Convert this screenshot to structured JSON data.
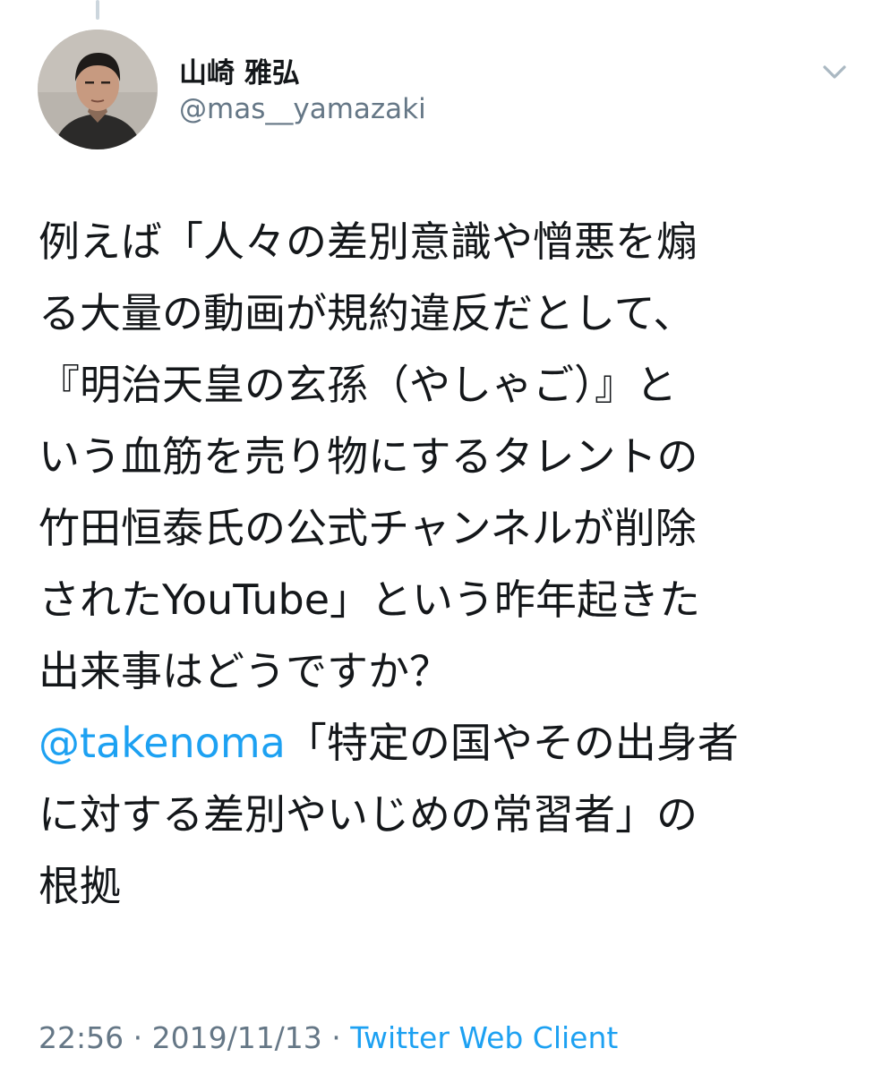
{
  "author": {
    "display_name": "山崎 雅弘",
    "handle": "@mas__yamazaki"
  },
  "icons": {
    "avatar": "profile-photo",
    "menu": "chevron-down-icon"
  },
  "tweet": {
    "lines": [
      {
        "text": "例えば「人々の差別意識や憎悪を煽"
      },
      {
        "text": "る大量の動画が規約違反だとして、"
      },
      {
        "text": "『明治天皇の玄孫（やしゃご）』と"
      },
      {
        "text": "いう血筋を売り物にするタレントの"
      },
      {
        "text": "竹田恒泰氏の公式チャンネルが削除"
      },
      {
        "text": "されたYouTube」という昨年起きた"
      },
      {
        "text": "出来事はどうですか？"
      },
      {
        "mention": "@takenoma",
        "text": "「特定の国やその出身者"
      },
      {
        "text": "に対する差別やいじめの常習者」の"
      },
      {
        "text": "根拠"
      }
    ]
  },
  "meta": {
    "time": "22:56",
    "separator": " · ",
    "date": "2019/11/13",
    "client": "Twitter Web Client"
  },
  "colors": {
    "text": "#14171a",
    "secondary": "#657786",
    "link": "#1da1f2",
    "chevron": "#aab8c2"
  }
}
